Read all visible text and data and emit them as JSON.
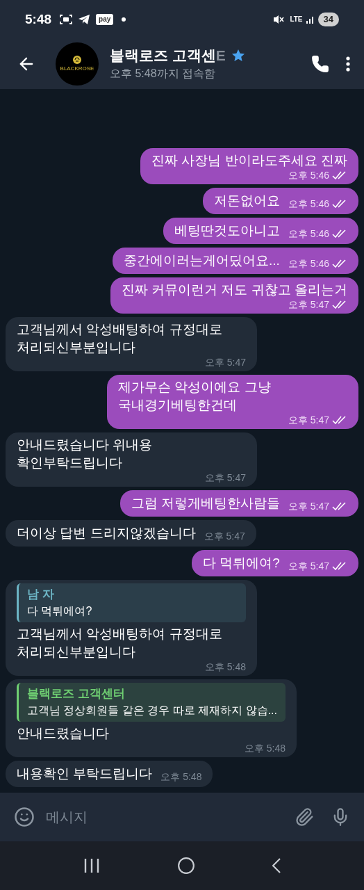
{
  "status_bar": {
    "time": "5:48",
    "pay_badge": "pay",
    "network": "LTE",
    "battery": "34"
  },
  "header": {
    "title": "블랙로즈 고객센",
    "title_faded": "E",
    "subtitle": "오후 5:48까지 접속함",
    "avatar_text": "BLACKROSE"
  },
  "messages": [
    {
      "kind": "outgoing",
      "text": "진짜 사장님 반이라도주세요 진짜",
      "time": "오후 5:46",
      "read": true
    },
    {
      "kind": "outgoing",
      "text": "저돈없어요",
      "time": "오후 5:46",
      "read": true
    },
    {
      "kind": "outgoing",
      "text": "베팅딴것도아니고",
      "time": "오후 5:46",
      "read": true
    },
    {
      "kind": "outgoing",
      "text": "중간에이러는게어딨어요...",
      "time": "오후 5:46",
      "read": true
    },
    {
      "kind": "outgoing",
      "text": "진짜 커뮤이런거 저도 귀찮고 올리는거",
      "time": "오후 5:47",
      "read": true
    },
    {
      "kind": "incoming",
      "text": "고객님께서 악성배팅하여 규정대로 처리되신부분입니다",
      "time": "오후 5:47"
    },
    {
      "kind": "outgoing",
      "text": "제가무슨 악성이에요 그냥 국내경기베팅한건데",
      "time": "오후 5:47",
      "read": true
    },
    {
      "kind": "incoming",
      "text": "안내드렸습니다 위내용 확인부탁드립니다",
      "time": "오후 5:47"
    },
    {
      "kind": "outgoing",
      "text": "그럼 저렇게베팅한사람들",
      "time": "오후 5:47",
      "read": true
    },
    {
      "kind": "incoming",
      "text": "더이상 답변 드리지않겠습니다",
      "time": "오후 5:47"
    },
    {
      "kind": "outgoing",
      "text": "다 먹튀에여?",
      "time": "오후 5:47",
      "read": true
    },
    {
      "kind": "incoming",
      "text": "고객님께서 악성배팅하여 규정대로 처리되신부분입니다",
      "time": "오후 5:48",
      "reply": {
        "author": "남 자",
        "text": "다 먹튀에여?",
        "color": "#6cb4c4"
      }
    },
    {
      "kind": "incoming",
      "text": "안내드렸습니다",
      "time": "오후 5:48",
      "reply": {
        "author": "블랙로즈 고객센터",
        "text": "고객님 정상회원들 같은 경우 따로 제재하지 않습...",
        "color": "#6fcf72"
      }
    },
    {
      "kind": "incoming",
      "text": "내용확인 부탁드립니다",
      "time": "오후 5:48"
    }
  ],
  "composer": {
    "placeholder": "메시지"
  }
}
